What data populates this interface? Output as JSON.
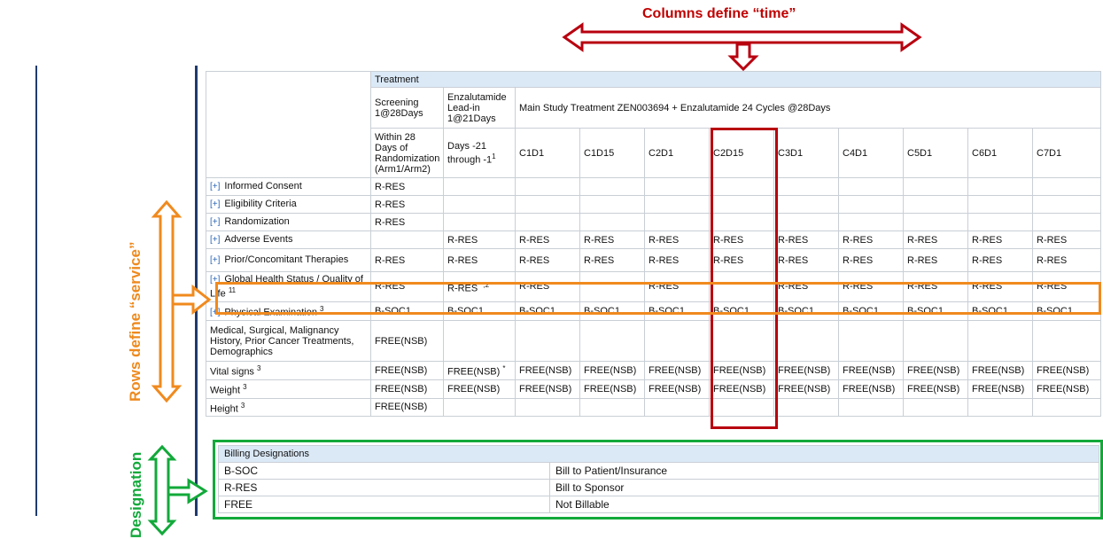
{
  "annotations": {
    "columns_title": "Columns define “time”",
    "rows_title": "Rows define “service”",
    "designation_title": "Designation"
  },
  "colors": {
    "red": "#b8000f",
    "orange": "#f08a1e",
    "green": "#12a93a",
    "navy": "#1f3b6e",
    "header_blue": "#dbe9f7"
  },
  "schedule": {
    "header_treatment": "Treatment",
    "period_headers": [
      "Screening 1@28Days",
      "Enzalutamide Lead-in 1@21Days",
      "Main Study Treatment ZEN003694 + Enzalutamide 24 Cycles @28Days"
    ],
    "visit_headers": [
      "Within 28 Days of Randomization (Arm1/Arm2)",
      "Days -21 through -1",
      "C1D1",
      "C1D15",
      "C2D1",
      "C2D15",
      "C3D1",
      "C4D1",
      "C5D1",
      "C6D1",
      "C7D1"
    ],
    "visit_sup": {
      "lead_in": "1"
    },
    "rows": [
      {
        "label": "Informed Consent",
        "expand": true,
        "sup": "",
        "cells": [
          "R-RES",
          "",
          "",
          "",
          "",
          "",
          "",
          "",
          "",
          "",
          ""
        ]
      },
      {
        "label": "Eligibility Criteria",
        "expand": true,
        "sup": "",
        "cells": [
          "R-RES",
          "",
          "",
          "",
          "",
          "",
          "",
          "",
          "",
          "",
          ""
        ]
      },
      {
        "label": "Randomization",
        "expand": true,
        "sup": "",
        "cells": [
          "R-RES",
          "",
          "",
          "",
          "",
          "",
          "",
          "",
          "",
          "",
          ""
        ]
      },
      {
        "label": "Adverse Events",
        "expand": true,
        "sup": "",
        "cells": [
          "",
          "R-RES",
          "R-RES",
          "R-RES",
          "R-RES",
          "R-RES",
          "R-RES",
          "R-RES",
          "R-RES",
          "R-RES",
          "R-RES"
        ]
      },
      {
        "label": "Prior/Concomitant Therapies",
        "expand": true,
        "sup": "",
        "cells": [
          "R-RES",
          "R-RES",
          "R-RES",
          "R-RES",
          "R-RES",
          "R-RES",
          "R-RES",
          "R-RES",
          "R-RES",
          "R-RES",
          "R-RES"
        ]
      },
      {
        "label": "Global Health Status / Quality of Life",
        "expand": true,
        "sup": "11",
        "cells": [
          "R-RES",
          "R-RES",
          "R-RES",
          "",
          "R-RES",
          "",
          "R-RES",
          "R-RES",
          "R-RES",
          "R-RES",
          "R-RES"
        ]
      },
      {
        "label": "Physical Examination",
        "expand": true,
        "sup": "3",
        "cells": [
          "B-SOC1",
          "B-SOC1",
          "B-SOC1",
          "B-SOC1",
          "B-SOC1",
          "B-SOC1",
          "B-SOC1",
          "B-SOC1",
          "B-SOC1",
          "B-SOC1",
          "B-SOC1"
        ]
      },
      {
        "label": "Medical, Surgical, Malignancy History, Prior Cancer Treatments, Demographics",
        "expand": false,
        "sup": "",
        "cells": [
          "FREE(NSB)",
          "",
          "",
          "",
          "",
          "",
          "",
          "",
          "",
          "",
          ""
        ]
      },
      {
        "label": "Vital signs",
        "expand": false,
        "sup": "3",
        "cells": [
          "FREE(NSB)",
          "FREE(NSB)",
          "FREE(NSB)",
          "FREE(NSB)",
          "FREE(NSB)",
          "FREE(NSB)",
          "FREE(NSB)",
          "FREE(NSB)",
          "FREE(NSB)",
          "FREE(NSB)",
          "FREE(NSB)"
        ]
      },
      {
        "label": "Weight",
        "expand": false,
        "sup": "3",
        "cells": [
          "FREE(NSB)",
          "FREE(NSB)",
          "FREE(NSB)",
          "FREE(NSB)",
          "FREE(NSB)",
          "FREE(NSB)",
          "FREE(NSB)",
          "FREE(NSB)",
          "FREE(NSB)",
          "FREE(NSB)",
          "FREE(NSB)"
        ]
      },
      {
        "label": "Height",
        "expand": false,
        "sup": "3",
        "cells": [
          "FREE(NSB)",
          "",
          "",
          "",
          "",
          "",
          "",
          "",
          "",
          "",
          ""
        ]
      }
    ],
    "cell_sups": {
      "5-1": "*,2",
      "8-1": "*"
    }
  },
  "billing": {
    "header": "Billing Designations",
    "rows": [
      {
        "code": "B-SOC",
        "description": "Bill to Patient/Insurance"
      },
      {
        "code": "R-RES",
        "description": "Bill to Sponsor"
      },
      {
        "code": "FREE",
        "description": "Not Billable"
      }
    ]
  }
}
